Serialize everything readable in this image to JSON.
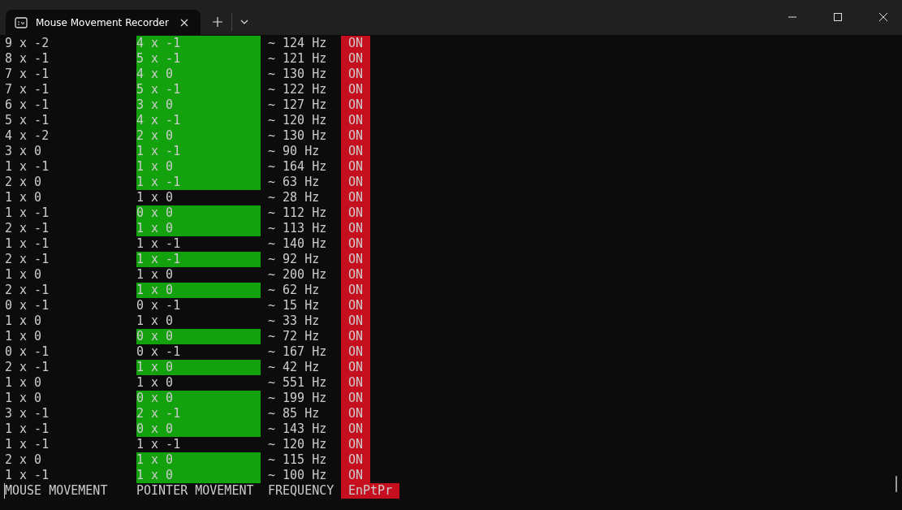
{
  "window": {
    "tab": {
      "title": "Mouse Movement Recorder",
      "selected": true
    }
  },
  "rows": [
    {
      "mouse": "9 x -2",
      "pointer": "4 x -1",
      "frequency": "~ 124 Hz",
      "state": "ON",
      "highlighted": true
    },
    {
      "mouse": "8 x -1",
      "pointer": "5 x -1",
      "frequency": "~ 121 Hz",
      "state": "ON",
      "highlighted": true
    },
    {
      "mouse": "7 x -1",
      "pointer": "4 x 0",
      "frequency": "~ 130 Hz",
      "state": "ON",
      "highlighted": true
    },
    {
      "mouse": "7 x -1",
      "pointer": "5 x -1",
      "frequency": "~ 122 Hz",
      "state": "ON",
      "highlighted": true
    },
    {
      "mouse": "6 x -1",
      "pointer": "3 x 0",
      "frequency": "~ 127 Hz",
      "state": "ON",
      "highlighted": true
    },
    {
      "mouse": "5 x -1",
      "pointer": "4 x -1",
      "frequency": "~ 120 Hz",
      "state": "ON",
      "highlighted": true
    },
    {
      "mouse": "4 x -2",
      "pointer": "2 x 0",
      "frequency": "~ 130 Hz",
      "state": "ON",
      "highlighted": true
    },
    {
      "mouse": "3 x 0",
      "pointer": "1 x -1",
      "frequency": "~ 90 Hz",
      "state": "ON",
      "highlighted": true
    },
    {
      "mouse": "1 x -1",
      "pointer": "1 x 0",
      "frequency": "~ 164 Hz",
      "state": "ON",
      "highlighted": true
    },
    {
      "mouse": "2 x 0",
      "pointer": "1 x -1",
      "frequency": "~ 63 Hz",
      "state": "ON",
      "highlighted": true
    },
    {
      "mouse": "1 x 0",
      "pointer": "1 x 0",
      "frequency": "~ 28 Hz",
      "state": "ON",
      "highlighted": false
    },
    {
      "mouse": "1 x -1",
      "pointer": "0 x 0",
      "frequency": "~ 112 Hz",
      "state": "ON",
      "highlighted": true
    },
    {
      "mouse": "2 x -1",
      "pointer": "1 x 0",
      "frequency": "~ 113 Hz",
      "state": "ON",
      "highlighted": true
    },
    {
      "mouse": "1 x -1",
      "pointer": "1 x -1",
      "frequency": "~ 140 Hz",
      "state": "ON",
      "highlighted": false
    },
    {
      "mouse": "2 x -1",
      "pointer": "1 x -1",
      "frequency": "~ 92 Hz",
      "state": "ON",
      "highlighted": true
    },
    {
      "mouse": "1 x 0",
      "pointer": "1 x 0",
      "frequency": "~ 200 Hz",
      "state": "ON",
      "highlighted": false
    },
    {
      "mouse": "2 x -1",
      "pointer": "1 x 0",
      "frequency": "~ 62 Hz",
      "state": "ON",
      "highlighted": true
    },
    {
      "mouse": "0 x -1",
      "pointer": "0 x -1",
      "frequency": "~ 15 Hz",
      "state": "ON",
      "highlighted": false
    },
    {
      "mouse": "1 x 0",
      "pointer": "1 x 0",
      "frequency": "~ 33 Hz",
      "state": "ON",
      "highlighted": false
    },
    {
      "mouse": "1 x 0",
      "pointer": "0 x 0",
      "frequency": "~ 72 Hz",
      "state": "ON",
      "highlighted": true
    },
    {
      "mouse": "0 x -1",
      "pointer": "0 x -1",
      "frequency": "~ 167 Hz",
      "state": "ON",
      "highlighted": false
    },
    {
      "mouse": "2 x -1",
      "pointer": "1 x 0",
      "frequency": "~ 42 Hz",
      "state": "ON",
      "highlighted": true
    },
    {
      "mouse": "1 x 0",
      "pointer": "1 x 0",
      "frequency": "~ 551 Hz",
      "state": "ON",
      "highlighted": false
    },
    {
      "mouse": "1 x 0",
      "pointer": "0 x 0",
      "frequency": "~ 199 Hz",
      "state": "ON",
      "highlighted": true
    },
    {
      "mouse": "3 x -1",
      "pointer": "2 x -1",
      "frequency": "~ 85 Hz",
      "state": "ON",
      "highlighted": true
    },
    {
      "mouse": "1 x -1",
      "pointer": "0 x 0",
      "frequency": "~ 143 Hz",
      "state": "ON",
      "highlighted": true
    },
    {
      "mouse": "1 x -1",
      "pointer": "1 x -1",
      "frequency": "~ 120 Hz",
      "state": "ON",
      "highlighted": false
    },
    {
      "mouse": "2 x 0",
      "pointer": "1 x 0",
      "frequency": "~ 115 Hz",
      "state": "ON",
      "highlighted": true
    },
    {
      "mouse": "1 x -1",
      "pointer": "1 x 0",
      "frequency": "~ 100 Hz",
      "state": "ON",
      "highlighted": true
    }
  ],
  "footer": {
    "mouse": "MOUSE MOVEMENT",
    "pointer": "POINTER MOVEMENT",
    "frequency": "FREQUENCY",
    "state": "EnPtPr"
  }
}
